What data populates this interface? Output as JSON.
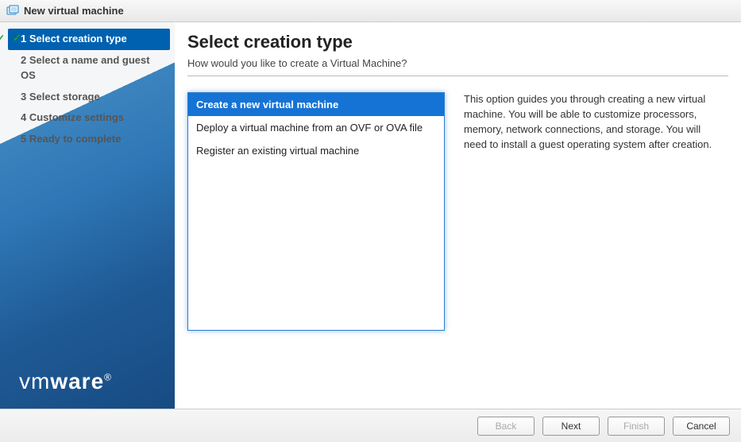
{
  "titlebar": {
    "title": "New virtual machine"
  },
  "sidebar": {
    "steps": [
      {
        "label": "1 Select creation type"
      },
      {
        "label": "2 Select a name and guest OS"
      },
      {
        "label": "3 Select storage"
      },
      {
        "label": "4 Customize settings"
      },
      {
        "label": "5 Ready to complete"
      }
    ]
  },
  "brand": {
    "text_left": "vm",
    "text_right": "ware",
    "reg": "®"
  },
  "main": {
    "title": "Select creation type",
    "subtitle": "How would you like to create a Virtual Machine?",
    "options": [
      {
        "label": "Create a new virtual machine"
      },
      {
        "label": "Deploy a virtual machine from an OVF or OVA file"
      },
      {
        "label": "Register an existing virtual machine"
      }
    ],
    "description": "This option guides you through creating a new virtual machine. You will be able to customize processors, memory, network connections, and storage. You will need to install a guest operating system after creation."
  },
  "footer": {
    "back": "Back",
    "next": "Next",
    "finish": "Finish",
    "cancel": "Cancel"
  }
}
